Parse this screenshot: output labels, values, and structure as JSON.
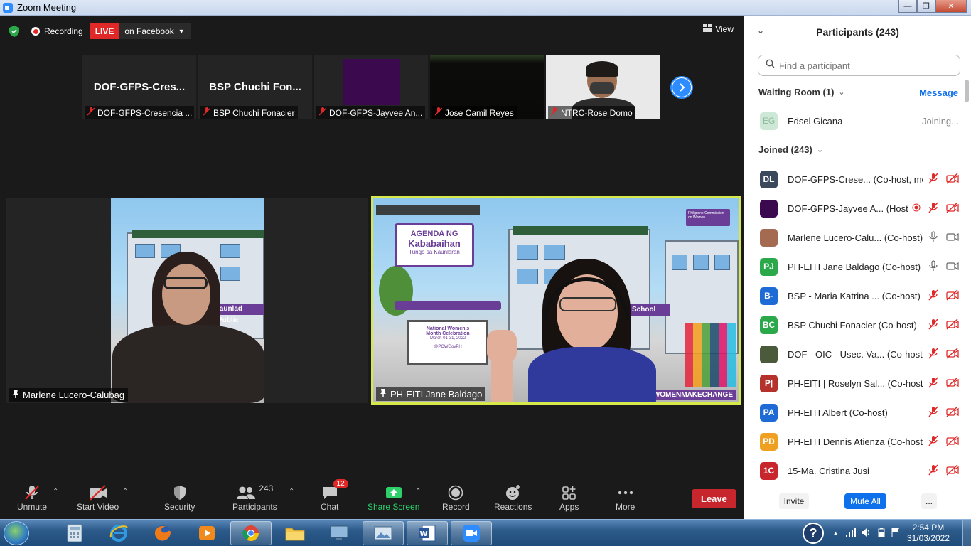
{
  "window": {
    "title": "Zoom Meeting"
  },
  "meeting_top": {
    "recording_label": "Recording",
    "live_badge": "LIVE",
    "live_destination": "on Facebook",
    "view_label": "View"
  },
  "thumbnails": [
    {
      "big_name": "DOF-GFPS-Cres...",
      "label": "DOF-GFPS-Cresencia ..."
    },
    {
      "big_name": "BSP Chuchi Fon...",
      "label": "BSP Chuchi Fonacier"
    },
    {
      "big_name": "",
      "label": "DOF-GFPS-Jayvee An..."
    },
    {
      "big_name": "",
      "label": "Jose Camil Reyes"
    },
    {
      "big_name": "",
      "label": "NTRC-Rose Domo"
    }
  ],
  "main_videos": [
    {
      "label": "Marlene Lucero-Calubag",
      "sign_text": "launlad Public"
    },
    {
      "label": "PH-EITI Jane Baldago",
      "banner_line1": "AGENDA NG",
      "banner_line2": "Kababaihan",
      "banner_line3": "Tungo sa Kaunlaran",
      "board_line1": "National Women's",
      "board_line2": "Month Celebration",
      "board_line3": "March 01-31, 2022",
      "board_handle": "@PCWGovPH",
      "school_text": "School",
      "hashtag": "#WOMENMAKECHANGE",
      "pcw_logo_text": "Philippine Commission on Women"
    }
  ],
  "toolbar": {
    "unmute": "Unmute",
    "start_video": "Start Video",
    "security": "Security",
    "participants": "Participants",
    "participants_count": "243",
    "chat": "Chat",
    "chat_badge": "12",
    "share_screen": "Share Screen",
    "record": "Record",
    "reactions": "Reactions",
    "apps": "Apps",
    "more": "More",
    "leave": "Leave"
  },
  "panel": {
    "title": "Participants (243)",
    "search_placeholder": "Find a participant",
    "waiting_room": "Waiting Room (1)",
    "message_link": "Message",
    "waiting": [
      {
        "initials": "EG",
        "name": "Edsel Gicana",
        "status": "Joining...",
        "color": "#cde8d6"
      }
    ],
    "joined": "Joined (243)",
    "participants": [
      {
        "initials": "DL",
        "name": "DOF-GFPS-Crese... (Co-host, me)",
        "color": "#3a4a5c",
        "icons": "mic-video-off"
      },
      {
        "initials": "",
        "name": "DOF-GFPS-Jayvee A... (Host)",
        "color": "#3b0a4e",
        "icons": "rec-mic-video-off"
      },
      {
        "initials": "",
        "name": "Marlene Lucero-Calu... (Co-host)",
        "color": "#a56b52",
        "icons": "mic-video-on"
      },
      {
        "initials": "PJ",
        "name": "PH-EITI Jane Baldago (Co-host)",
        "color": "#2aa84a",
        "icons": "mic-video-on"
      },
      {
        "initials": "B-",
        "name": "BSP - Maria Katrina ... (Co-host)",
        "color": "#1e6bd6",
        "icons": "mic-video-off"
      },
      {
        "initials": "BC",
        "name": "BSP Chuchi Fonacier (Co-host)",
        "color": "#2aa84a",
        "icons": "mic-video-off"
      },
      {
        "initials": "",
        "name": "DOF - OIC - Usec. Va... (Co-host)",
        "color": "#4b5a3a",
        "icons": "mic-video-off"
      },
      {
        "initials": "P|",
        "name": "PH-EITI | Roselyn Sal... (Co-host)",
        "color": "#b5312b",
        "icons": "mic-video-off"
      },
      {
        "initials": "PA",
        "name": "PH-EITI Albert (Co-host)",
        "color": "#1e6bd6",
        "icons": "mic-video-off"
      },
      {
        "initials": "PD",
        "name": "PH-EITI Dennis Atienza (Co-host)",
        "color": "#f0a020",
        "icons": "mic-video-off"
      },
      {
        "initials": "1C",
        "name": "15-Ma. Cristina Jusi",
        "color": "#c8262d",
        "icons": "mic-video-off"
      }
    ],
    "invite": "Invite",
    "mute_all": "Mute All",
    "more": "..."
  },
  "taskbar": {
    "time": "2:54 PM",
    "date": "31/03/2022"
  },
  "colors": {
    "zoom_blue": "#2d8cff",
    "live_red": "#e02828",
    "leave_red": "#c8262d",
    "active_speaker_border": "#d6e84a"
  }
}
